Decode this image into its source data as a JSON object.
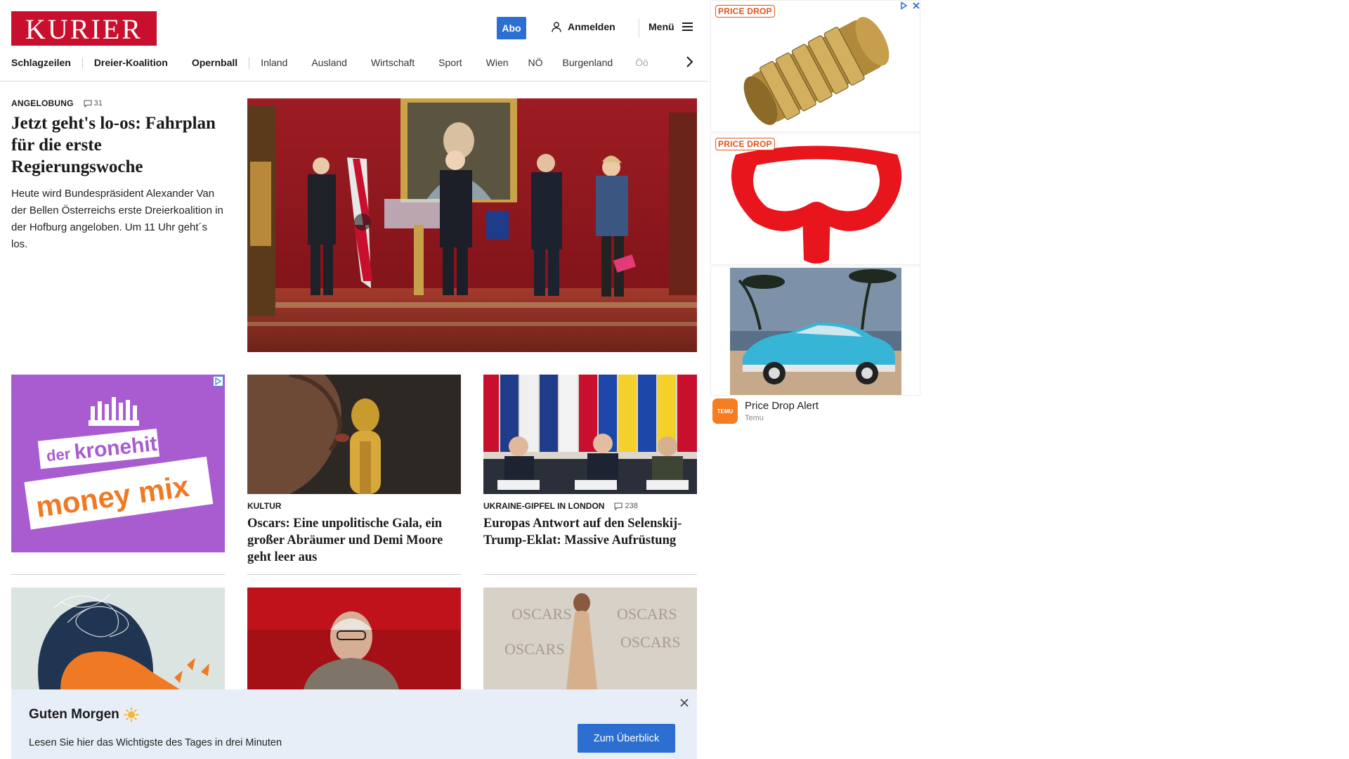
{
  "header": {
    "logo": "KURIER",
    "abo_label": "Abo",
    "login_label": "Anmelden",
    "menu_label": "Menü",
    "nav": [
      "Schlagzeilen",
      "Dreier-Koalition",
      "Opernball",
      "Inland",
      "Ausland",
      "Wirtschaft",
      "Sport",
      "Wien",
      "NÖ",
      "Burgenland",
      "Öö"
    ]
  },
  "lead": {
    "kicker": "ANGELOBUNG",
    "comments": "31",
    "title": "Jetzt geht's lo-os: Fahrplan für die erste Regierungswoche",
    "teaser": "Heute wird Bundespräsident Alexander Van der Bellen Österreichs erste Dreierkoalition in der Hofburg angeloben. Um 11 Uhr geht´s los."
  },
  "row2": {
    "ad": {
      "line1": "der",
      "line2": "kronehit",
      "line3": "money mix"
    },
    "oscars": {
      "kicker": "KULTUR",
      "title": "Oscars: Eine unpolitische Gala, ein großer Abräumer und Demi Moore geht leer aus"
    },
    "ukraine": {
      "kicker": "UKRAINE-GIPFEL IN LONDON",
      "comments": "238",
      "title": "Europas Antwort auf den Selenskij-Trump-Eklat: Massive Aufrüstung"
    }
  },
  "row3": {
    "oscars_wall": "OSCARS"
  },
  "right_ads": {
    "badge1": "PRICE DROP",
    "badge2": "PRICE DROP",
    "temu_logo": "TEMU",
    "temu_title": "Price Drop Alert",
    "temu_sub": "Temu"
  },
  "overlay": {
    "title": "Guten Morgen",
    "text": "Lesen Sie hier das Wichtigste des Tages in drei Minuten",
    "button": "Zum Überblick"
  },
  "colors": {
    "brand": "#c8102e",
    "accent": "#2d6ed1",
    "overlay_bg": "#e8eef8",
    "price_drop": "#e0541c"
  }
}
